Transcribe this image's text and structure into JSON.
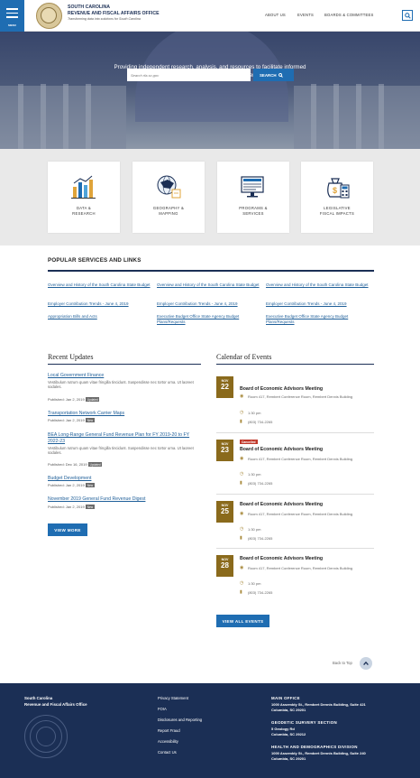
{
  "header": {
    "menu_label": "MENU",
    "org_line1": "SOUTH CAROLINA",
    "org_line2": "REVENUE AND FISCAL AFFAIRS OFFICE",
    "tagline": "Transforming data into solutions for South Carolina",
    "nav": [
      "ABOUT US",
      "EVENTS",
      "BOARDS & COMMITTEES"
    ]
  },
  "hero": {
    "text": "Providing independent research, analysis, and resources to facilitate informed policy decisions and administration of services",
    "search_placeholder": "Search rfa.sc.gov",
    "search_button": "SEARCH"
  },
  "tiles": [
    {
      "line1": "DATA &",
      "line2": "RESEARCH",
      "icon": "bar-chart-icon"
    },
    {
      "line1": "GEOGRAPHY &",
      "line2": "MAPPING",
      "icon": "globe-map-icon"
    },
    {
      "line1": "PROGRAMS &",
      "line2": "SERVICES",
      "icon": "screen-icon"
    },
    {
      "line1": "LEGISLATIVE",
      "line2": "FISCAL IMPACTS",
      "icon": "money-calculator-icon"
    }
  ],
  "popular": {
    "title": "POPULAR SERVICES AND LINKS",
    "links": [
      [
        "Overview and History of the South Carolina State Budget",
        "Overview and History of the South Carolina State Budget",
        "Overview and History of the South Carolina State Budget"
      ],
      [
        "Employer Contribution Trends - June 4, 2019",
        "Employer Contribution Trends - June 4, 2019",
        "Employer Contribution Trends - June 4, 2019"
      ],
      [
        "Appropriation Bills and Acts",
        "Executive Budget Office State Agency Budget Plans/Requests",
        "Executive Budget Office State Agency Budget Plans/Requests"
      ]
    ]
  },
  "updates": {
    "title": "Recent Updates",
    "items": [
      {
        "title": "Local Government Finance",
        "body": "Vestibulum rutrum quam vitae fringilla tincidunt. Suspendisse nec tortor urna. Ut laoreet sodales.",
        "date": "Published: Jan 2, 2019",
        "badge": "Updated"
      },
      {
        "title": "Transportation Network Carrier Maps",
        "body": "",
        "date": "Published: Jan 2, 2019",
        "badge": "New"
      },
      {
        "title": "BEA Long-Range General Fund Revenue Plan for FY 2019-20 to FY 2022-23",
        "body": "Vestibulum rutrum quam vitae fringilla tincidunt. Suspendisse nec tortor urna. Ut laoreet sodales.",
        "date": "Published: Dec 16, 2019",
        "badge": "Updated"
      },
      {
        "title": "Budget Development",
        "body": "",
        "date": "Published: Jan 2, 2019",
        "badge": "New"
      },
      {
        "title": "November 2019 General Fund Revenue Digest",
        "body": "",
        "date": "Published: Jan 2, 2019",
        "badge": "New"
      }
    ],
    "view_more": "VIEW MORE"
  },
  "events": {
    "title": "Calendar of Events",
    "items": [
      {
        "month": "NOV",
        "day": "22",
        "cancelled": "",
        "title": "Board of Economic Advisors Meeting",
        "location": "Room 417, Rembert Conference Room, Rembert Dennis Building",
        "time": "1:30 pm",
        "phone": "(803) 734-2265"
      },
      {
        "month": "NOV",
        "day": "23",
        "cancelled": "Cancelled",
        "title": "Board of Economic Advisors Meeting",
        "location": "Room 417, Rembert Conference Room, Rembert Dennis Building",
        "time": "1:30 pm",
        "phone": "(803) 734-2265"
      },
      {
        "month": "NOV",
        "day": "25",
        "cancelled": "",
        "title": "Board of Economic Advisors Meeting",
        "location": "Room 417, Rembert Conference Room, Rembert Dennis Building",
        "time": "1:30 pm",
        "phone": "(803) 734-2265"
      },
      {
        "month": "NOV",
        "day": "28",
        "cancelled": "",
        "title": "Board of Economic Advisors Meeting",
        "location": "Room 417, Rembert Conference Room, Rembert Dennis Building",
        "time": "1:30 pm",
        "phone": "(803) 734-2265"
      }
    ],
    "view_all": "VIEW ALL EVENTS"
  },
  "back_to_top": "Back to Top",
  "footer": {
    "org_line1": "South Carolina",
    "org_line2": "Revenue and Fiscal Affairs Office",
    "links": [
      "Privacy Statement",
      "FOIA",
      "Disclosures and Reporting",
      "Report Fraud",
      "Accessibility",
      "Contact Us"
    ],
    "offices": [
      {
        "head": "MAIN OFFICE",
        "line1": "1000 Assembly St., Rembert Dennis Building, Suite 421",
        "line2": "Columbia, SC 29201"
      },
      {
        "head": "GEODETIC SURVERY SECTION",
        "line1": "5 Geology Rd",
        "line2": "Columbia, SC 29212"
      },
      {
        "head": "HEALTH AND DEMOGRAPHICS DIVISION",
        "line1": "1000 Assembly St., Rembert Dennis Building, Suite 240",
        "line2": "Columbia, SC 29201"
      }
    ]
  },
  "colors": {
    "primary_blue": "#1f6db2",
    "navy": "#1b2f55",
    "event_gold": "#8a6a1c",
    "cancel_red": "#c0392b"
  }
}
